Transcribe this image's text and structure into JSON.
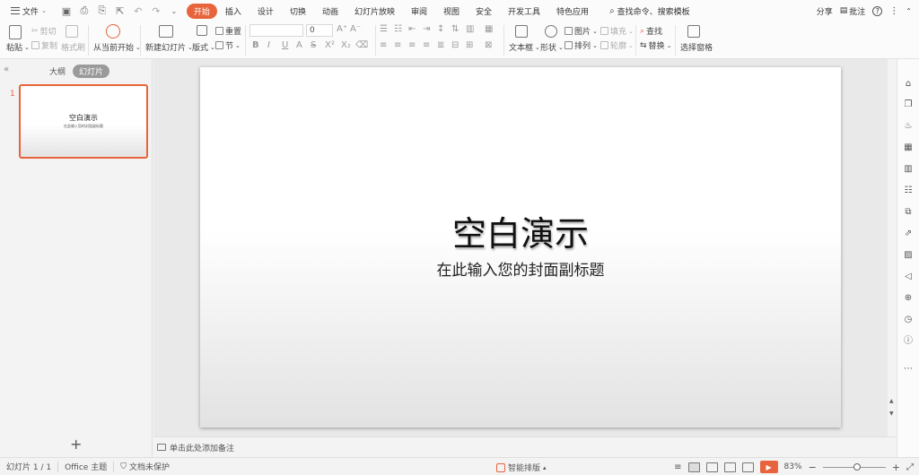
{
  "menubar": {
    "file_label": "文件",
    "tabs": [
      "开始",
      "插入",
      "设计",
      "切换",
      "动画",
      "幻灯片放映",
      "审阅",
      "视图",
      "安全",
      "开发工具",
      "特色应用"
    ],
    "search_label": "查找命令、搜索模板",
    "share_label": "分享",
    "comment_label": "批注"
  },
  "ribbon": {
    "paste": "粘贴",
    "cut": "剪切",
    "copy": "复制",
    "format_painter": "格式刷",
    "from_current": "从当前开始",
    "new_slide": "新建幻灯片",
    "layout": "版式",
    "reset": "重置",
    "section": "节",
    "font_size": "0",
    "textbox": "文本框",
    "shape": "形状",
    "picture": "图片",
    "arrange": "排列",
    "fill": "填充",
    "outline": "轮廓",
    "find": "查找",
    "replace": "替换",
    "selection_pane": "选择窗格"
  },
  "panel": {
    "outline_tab": "大纲",
    "slides_tab": "幻灯片",
    "slide_number": "1"
  },
  "slide": {
    "title": "空白演示",
    "subtitle": "在此输入您的封面副标题"
  },
  "notes": {
    "placeholder": "单击此处添加备注"
  },
  "status": {
    "slide_count": "幻灯片 1 / 1",
    "theme": "Office 主题",
    "protection": "文档未保护",
    "smart_layout": "智能排版",
    "zoom": "83%"
  },
  "colors": {
    "accent": "#e8643c"
  }
}
